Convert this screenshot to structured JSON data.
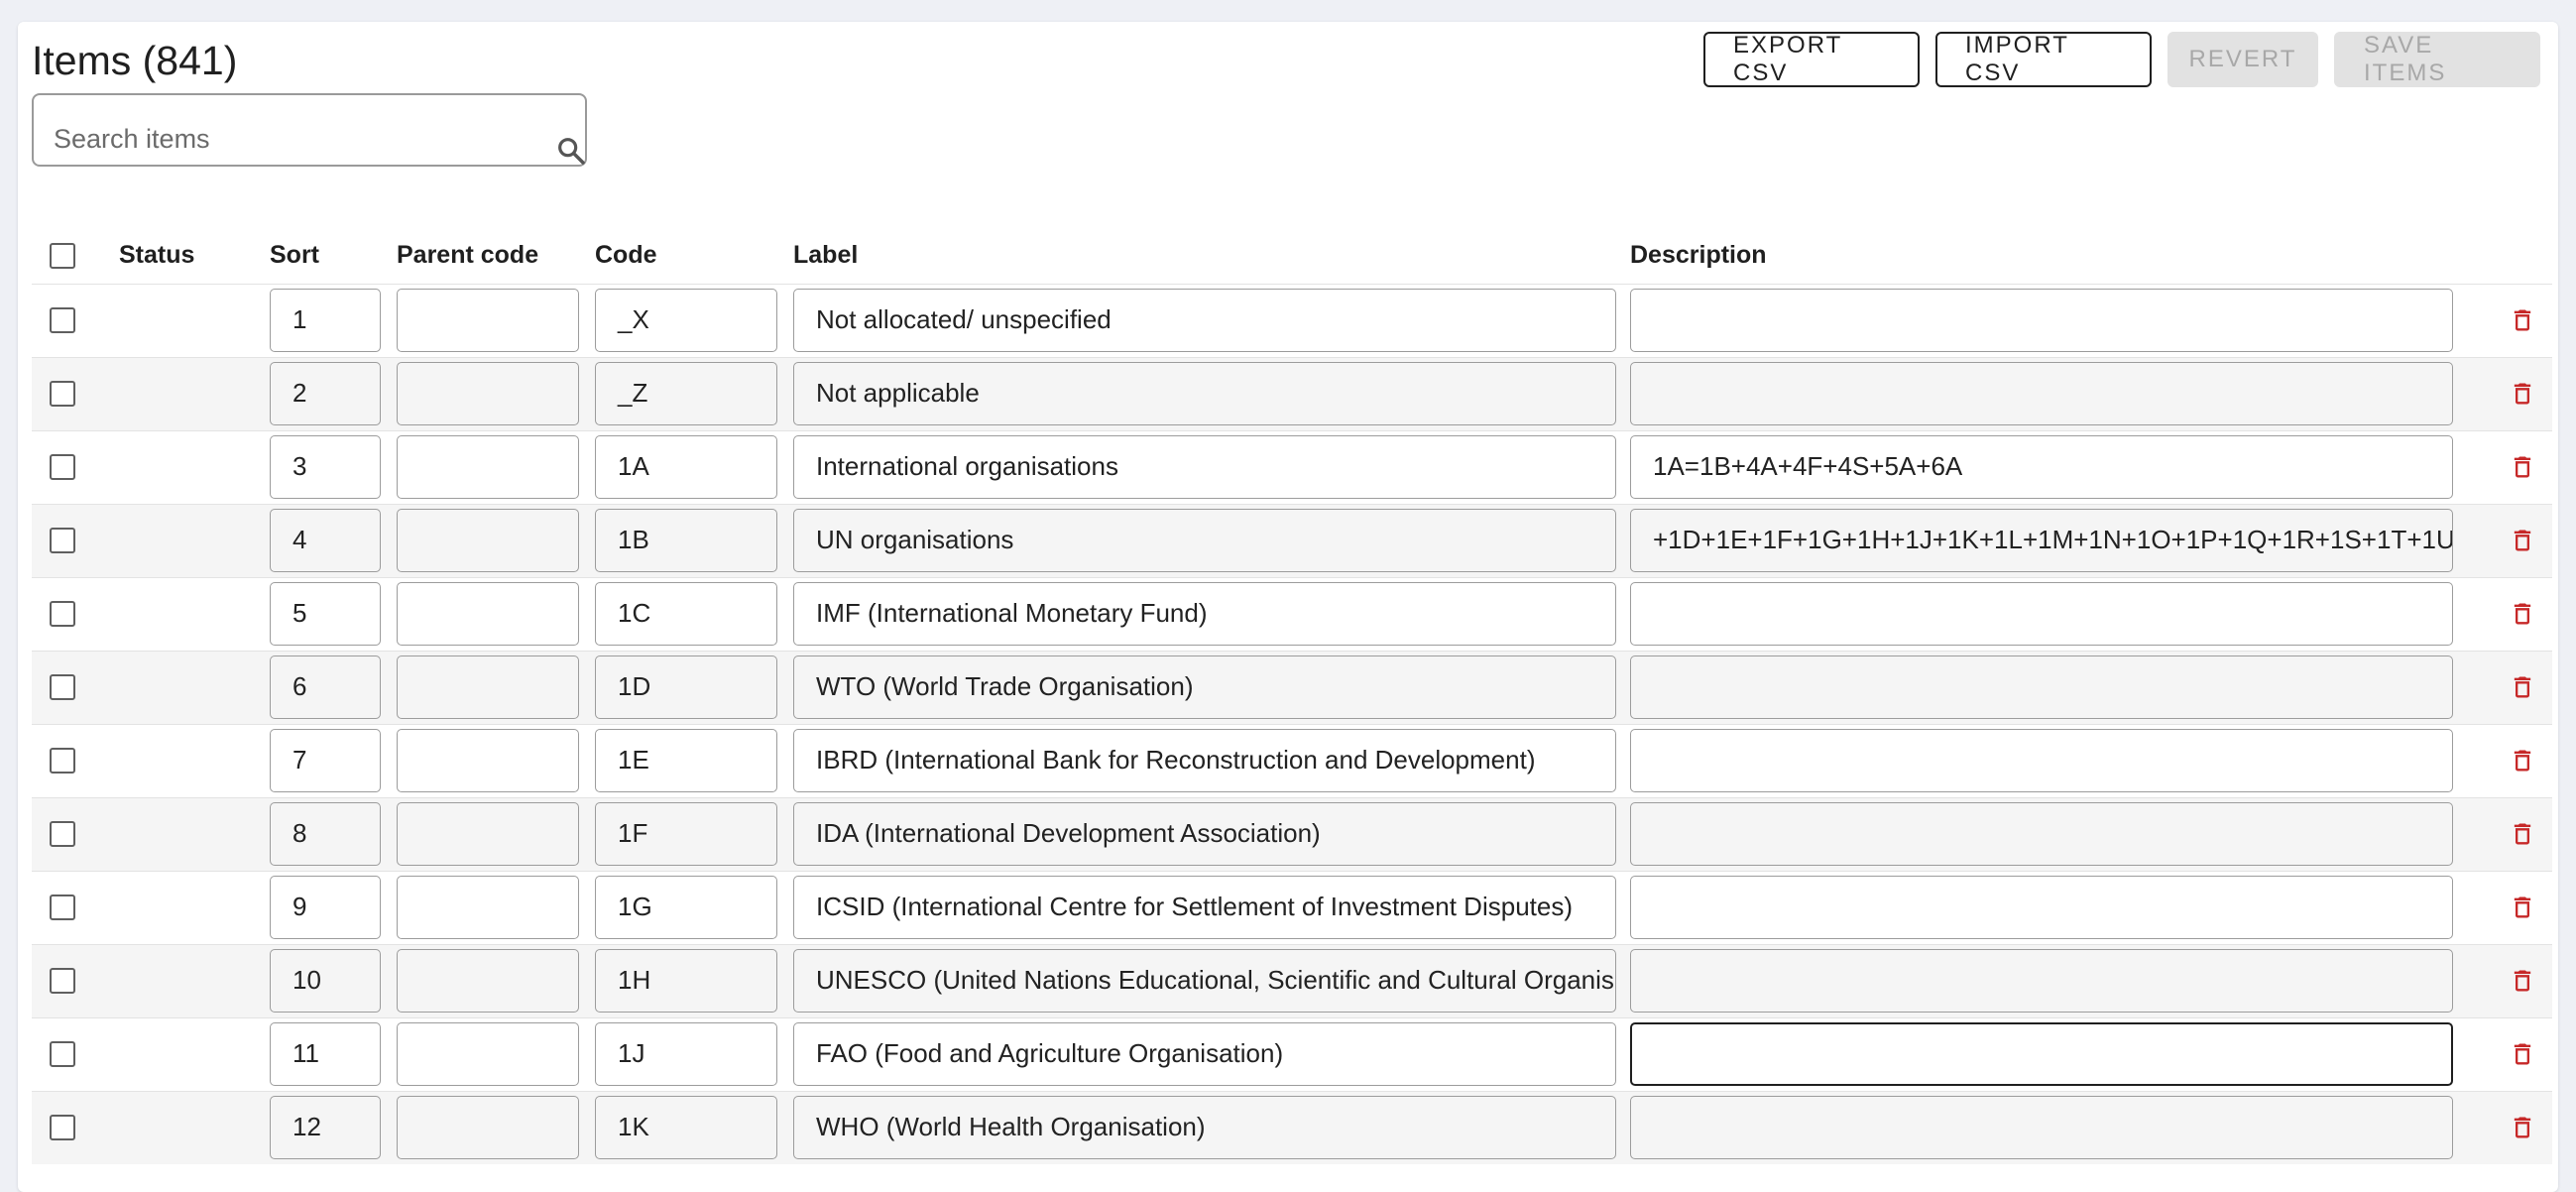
{
  "header": {
    "title": "Items (841)",
    "export_label": "EXPORT CSV",
    "import_label": "IMPORT CSV",
    "revert_label": "REVERT",
    "save_label": "SAVE ITEMS"
  },
  "search": {
    "placeholder": "Search items",
    "value": ""
  },
  "columns": {
    "status": "Status",
    "sort": "Sort",
    "parent": "Parent code",
    "code": "Code",
    "label": "Label",
    "description": "Description"
  },
  "colors": {
    "delete": "#c62828",
    "disabled_bg": "#e2e2e2",
    "disabled_text": "#a8a8a8"
  },
  "icons": {
    "search": "search-icon",
    "delete": "trash-icon"
  },
  "rows": [
    {
      "sort": "1",
      "parent": "",
      "code": "_X",
      "label": "Not allocated/ unspecified",
      "description": ""
    },
    {
      "sort": "2",
      "parent": "",
      "code": "_Z",
      "label": "Not applicable",
      "description": ""
    },
    {
      "sort": "3",
      "parent": "",
      "code": "1A",
      "label": "International organisations",
      "description": "1A=1B+4A+4F+4S+5A+6A"
    },
    {
      "sort": "4",
      "parent": "",
      "code": "1B",
      "label": "UN organisations",
      "description": "+1D+1E+1F+1G+1H+1J+1K+1L+1M+1N+1O+1P+1Q+1R+1S+1T+1U"
    },
    {
      "sort": "5",
      "parent": "",
      "code": "1C",
      "label": "IMF (International Monetary Fund)",
      "description": ""
    },
    {
      "sort": "6",
      "parent": "",
      "code": "1D",
      "label": "WTO (World Trade Organisation)",
      "description": ""
    },
    {
      "sort": "7",
      "parent": "",
      "code": "1E",
      "label": "IBRD (International Bank for Reconstruction and Development)",
      "description": ""
    },
    {
      "sort": "8",
      "parent": "",
      "code": "1F",
      "label": "IDA (International Development Association)",
      "description": ""
    },
    {
      "sort": "9",
      "parent": "",
      "code": "1G",
      "label": "ICSID (International Centre for Settlement of Investment Disputes)",
      "description": ""
    },
    {
      "sort": "10",
      "parent": "",
      "code": "1H",
      "label": "UNESCO (United Nations Educational, Scientific and Cultural Organis",
      "description": ""
    },
    {
      "sort": "11",
      "parent": "",
      "code": "1J",
      "label": "FAO (Food and Agriculture Organisation)",
      "description": ""
    },
    {
      "sort": "12",
      "parent": "",
      "code": "1K",
      "label": "WHO (World Health Organisation)",
      "description": ""
    }
  ]
}
